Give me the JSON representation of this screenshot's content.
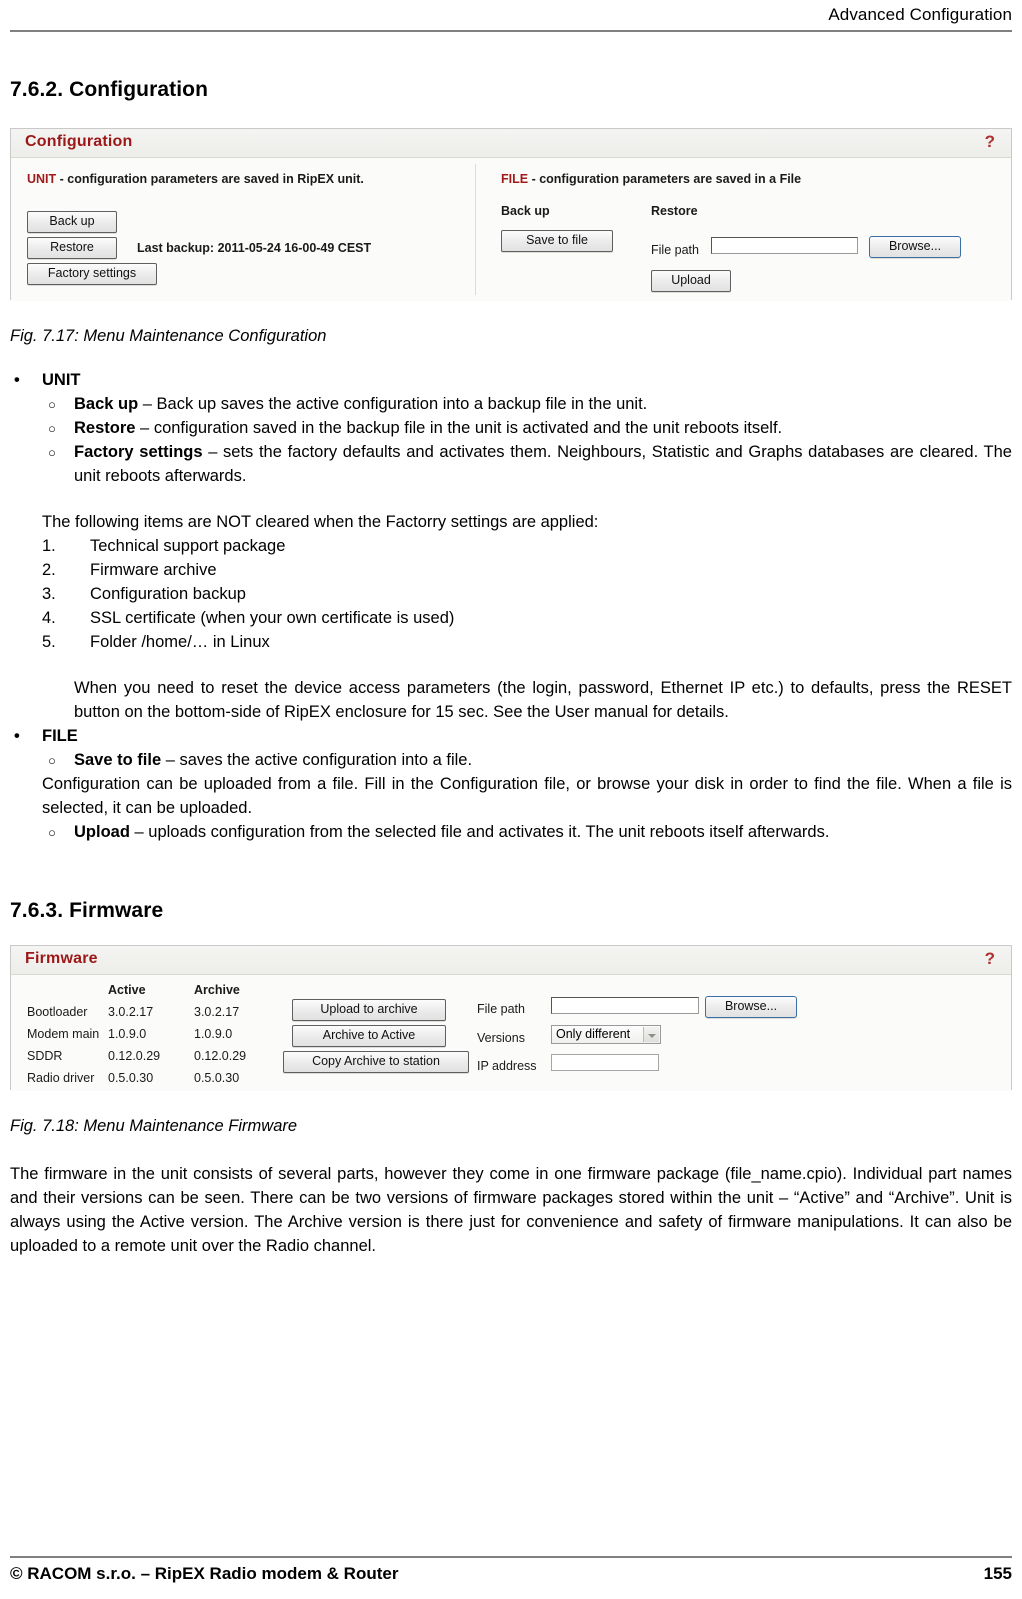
{
  "header": {
    "running_head": "Advanced Configuration"
  },
  "sections": {
    "configuration": {
      "heading": "7.6.2. Configuration",
      "figure_caption": "Fig. 7.17: Menu Maintenance Configuration"
    },
    "firmware": {
      "heading": "7.6.3. Firmware",
      "figure_caption": "Fig. 7.18: Menu Maintenance Firmware"
    }
  },
  "config_panel": {
    "title": "Configuration",
    "help_label": "?",
    "unit": {
      "key": "UNIT",
      "description": " - configuration parameters are saved in RipEX unit.",
      "backup_button": "Back up",
      "restore_button": "Restore",
      "factory_button": "Factory settings",
      "last_backup": "Last backup: 2011-05-24 16-00-49 CEST"
    },
    "file": {
      "key": "FILE",
      "description": " - configuration parameters are saved in a File",
      "backup_label": "Back up",
      "restore_label": "Restore",
      "save_to_file_button": "Save to file",
      "file_path_label": "File path",
      "file_path_value": "",
      "browse_button": "Browse...",
      "upload_button": "Upload"
    }
  },
  "firmware_panel": {
    "title": "Firmware",
    "help_label": "?",
    "columns": [
      "",
      "Active",
      "Archive"
    ],
    "rows": [
      {
        "name": "Bootloader",
        "active": "3.0.2.17",
        "archive": "3.0.2.17"
      },
      {
        "name": "Modem main",
        "active": "1.0.9.0",
        "archive": "1.0.9.0"
      },
      {
        "name": "SDDR",
        "active": "0.12.0.29",
        "archive": "0.12.0.29"
      },
      {
        "name": "Radio driver",
        "active": "0.5.0.30",
        "archive": "0.5.0.30"
      }
    ],
    "buttons": [
      "Upload to archive",
      "Archive to Active",
      "Copy Archive to station"
    ],
    "fields": {
      "file_path_label": "File path",
      "file_path_value": "",
      "browse_button": "Browse...",
      "versions_label": "Versions",
      "versions_value": "Only different",
      "ip_address_label": "IP address",
      "ip_address_value": ""
    }
  },
  "config_list": {
    "unit": {
      "label": "UNIT",
      "items": [
        {
          "term": "Back up",
          "dash": " – ",
          "text": "Back up saves the active configuration into a backup file in the unit."
        },
        {
          "term": "Restore",
          "dash": " – ",
          "text": "configuration saved in the backup file in the unit is activated and the unit reboots itself."
        },
        {
          "term": "Factory settings",
          "dash": " – ",
          "text": "sets the factory defaults and activates them. Neighbours, Statistic and Graphs databases are cleared. The unit reboots afterwards."
        }
      ],
      "not_cleared_intro": "The following items are NOT cleared when the Factorry settings are applied:",
      "not_cleared_items": [
        {
          "num": "1.",
          "text": "Technical support package"
        },
        {
          "num": "2.",
          "text": "Firmware archive"
        },
        {
          "num": "3.",
          "text": "Configuration backup"
        },
        {
          "num": "4.",
          "text": "SSL certificate (when your own certificate is used)"
        },
        {
          "num": "5.",
          "text": "Folder /home/… in Linux"
        }
      ],
      "reset_note": "When you need to reset the device access parameters (the login, password, Ethernet IP etc.) to defaults, press the RESET button on the bottom-side of RipEX enclosure for 15 sec. See the User manual for details."
    },
    "file": {
      "label": "FILE",
      "items": [
        {
          "term": "Save to file",
          "dash": " – ",
          "text": "saves the active configuration into a file."
        },
        {
          "term": "Upload",
          "dash": " – ",
          "text": "uploads configuration from the selected file and activates it. The unit reboots itself afterwards."
        }
      ],
      "save_to_file_continuation": "Configuration can be uploaded from a file. Fill in the Configuration file, or browse your disk in order to find the file. When a file is selected, it can be uploaded."
    }
  },
  "firmware_text": {
    "paragraph": "The firmware in the unit consists of several parts, however they come in one firmware package (file_name.cpio). Individual part names and their versions can be seen. There can be two versions of firmware packages stored within the unit – “Active” and “Archive”. Unit is always using the Active version. The Archive version is there just for convenience and safety of firmware manipulations. It can also be uploaded to a remote unit over the Radio channel."
  },
  "footer": {
    "copyright": "© RACOM s.r.o. – RipEX Radio modem & Router",
    "page_number": "155"
  },
  "colors": {
    "panel_header_red": "#9c1818",
    "rule_gray": "#808080",
    "panel_bg": "#fbfbf9"
  }
}
